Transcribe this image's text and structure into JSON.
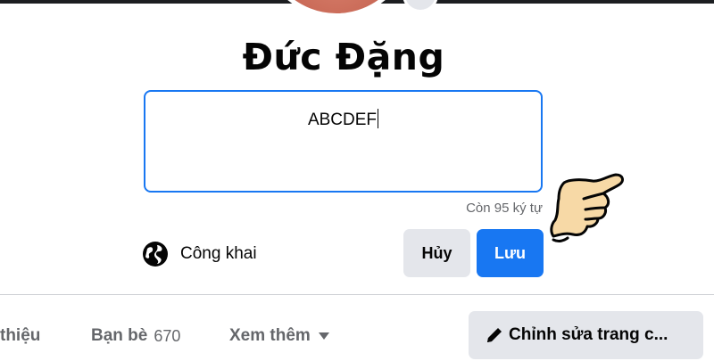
{
  "profile": {
    "name": "Đức Đặng"
  },
  "bio_editor": {
    "value": "ABCDEF",
    "remaining_text": "Còn 95 ký tự"
  },
  "privacy": {
    "label": "Công khai",
    "icon": "globe-icon"
  },
  "actions": {
    "cancel_label": "Hủy",
    "save_label": "Lưu"
  },
  "tabs": {
    "about_label": "thiệu",
    "friends_label": "Bạn bè",
    "friends_count": "670",
    "more_label": "Xem thêm"
  },
  "edit_profile": {
    "label": "Chỉnh sửa trang c...",
    "icon": "pencil-icon"
  },
  "colors": {
    "accent": "#1877f2",
    "button_gray": "#e4e6eb",
    "secondary_text": "#65676b",
    "hand_fill": "#f7d9a6"
  }
}
